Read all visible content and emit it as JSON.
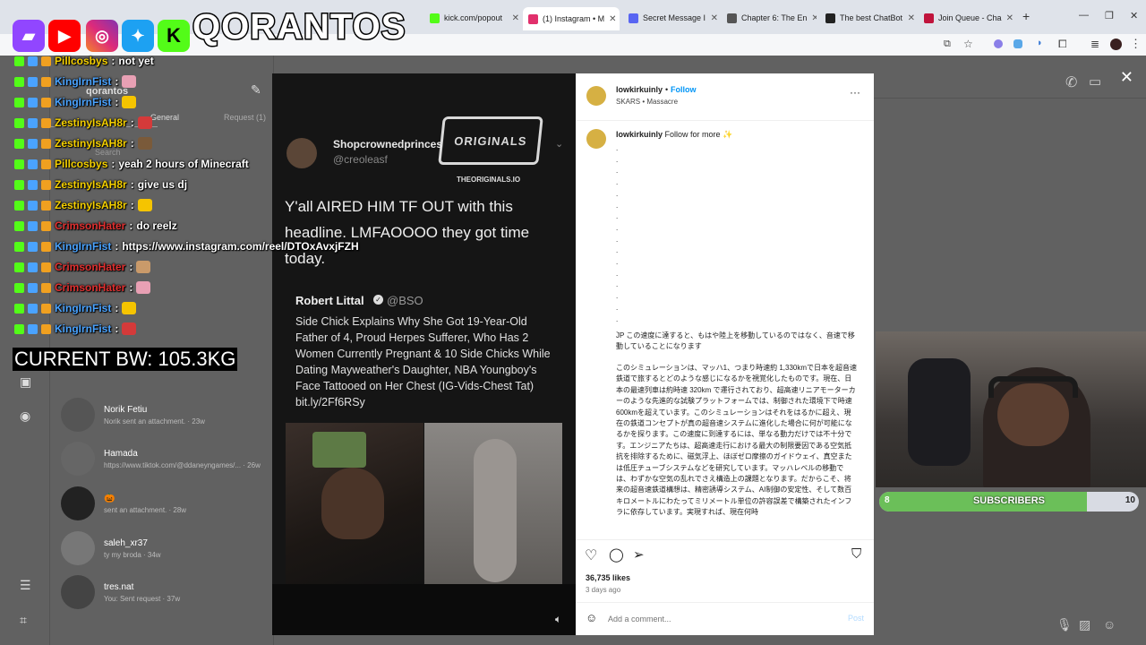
{
  "browser": {
    "tabs": [
      {
        "label": "kick.com/popout",
        "color": "#53fc18"
      },
      {
        "label": "(1) Instagram • M",
        "color": "#e1306c",
        "active": true
      },
      {
        "label": "Secret Message I",
        "color": "#5865f2"
      },
      {
        "label": "Chapter 6: The En",
        "color": "#555"
      },
      {
        "label": "The best ChatBot",
        "color": "#222"
      },
      {
        "label": "Join Queue - Cha",
        "color": "#c0143c"
      }
    ]
  },
  "instagram_bg": {
    "username": "qorantos",
    "tabs": [
      "General",
      "Request (1)"
    ],
    "search_placeholder": "Search",
    "conversations": [
      {
        "name": "Norik Fetiu",
        "preview": "Norik sent an attachment. · 23w"
      },
      {
        "name": "Hamada",
        "preview": "https://www.tiktok.com/@ddaneyngames/... · 26w"
      },
      {
        "name": "🎃",
        "preview": "sent an attachment. · 28w"
      },
      {
        "name": "saleh_xr37",
        "preview": "ty my broda · 34w"
      },
      {
        "name": "tres.nat",
        "preview": "You: Sent request · 37w"
      }
    ]
  },
  "overlay": {
    "brand": "QORANTOS",
    "bandwidth": "CURRENT BW: 105.3KG",
    "subscribers_label": "SUBSCRIBERS",
    "subscribers_current": "8",
    "subscribers_goal": "10",
    "subscribers_progress": 0.8,
    "chat": [
      {
        "user": "Pillcosbys",
        "color": "#f5d000",
        "msg": "not yet"
      },
      {
        "user": "KingIrnFist",
        "color": "#4aa3ff",
        "msg": ""
      },
      {
        "user": "KingIrnFist",
        "color": "#4aa3ff",
        "msg": ""
      },
      {
        "user": "ZestinyIsAH8r",
        "color": "#f5d000",
        "msg": ""
      },
      {
        "user": "ZestinyIsAH8r",
        "color": "#f5d000",
        "msg": ""
      },
      {
        "user": "Pillcosbys",
        "color": "#f5d000",
        "msg": "yeah 2 hours of Minecraft"
      },
      {
        "user": "ZestinyIsAH8r",
        "color": "#f5d000",
        "msg": "give us dj"
      },
      {
        "user": "ZestinyIsAH8r",
        "color": "#f5d000",
        "msg": ""
      },
      {
        "user": "CrimsonHater",
        "color": "#e03030",
        "msg": "do reelz"
      },
      {
        "user": "KingIrnFist",
        "color": "#4aa3ff",
        "msg": "https://www.instagram.com/reel/DTOxAvxjFZH"
      },
      {
        "user": "CrimsonHater",
        "color": "#e03030",
        "msg": ""
      },
      {
        "user": "CrimsonHater",
        "color": "#e03030",
        "msg": ""
      },
      {
        "user": "KingIrnFist",
        "color": "#4aa3ff",
        "msg": ""
      },
      {
        "user": "KingIrnFist",
        "color": "#4aa3ff",
        "msg": ""
      }
    ]
  },
  "post": {
    "tweet_handle_name": "Shopcrownedprinces",
    "tweet_handle": "@creoleasf",
    "tweet_text": "Y'all AIRED HIM TF OUT with this headline. LMFAOOOO they got time today.",
    "watermark": "THEORIGINALS.IO",
    "quoted_author": "Robert Littal",
    "quoted_handle": "@BSO",
    "quoted_text": "Side Chick Explains Why She Got 19-Year-Old Father of 4, Proud Herpes Sufferer, Who Has 2 Women Currently Pregnant & 10 Side Chicks While Dating Mayweather's Daughter, NBA Youngboy's Face Tattooed on Her Chest (IG-Vids-Chest Tat) bit.ly/2Ff6RSy",
    "account": "lowkirkuinly",
    "follow": "Follow",
    "audio": "SKARS • Massacre",
    "caption_prefix": "Follow for more ✨",
    "caption_jp_1": "JP この速度に達すると、もはや陸上を移動しているのではなく、音速で移動していることになります",
    "caption_jp_2": "このシミュレーションは、マッハ1、つまり時速約 1,330kmで日本を超音速鉄道で旅するとどのような感じになるかを視覚化したものです。現在、日本の最速列車は約時速 320km で運行されており、超高速リニアモーターカーのような先進的な試験プラットフォームでは、制御された環境下で時速600kmを超えています。このシミュレーションはそれをはるかに超え、現在の鉄道コンセプトが真の超音速システムに進化した場合に何が可能になるかを探ります。この速度に到達するには、単なる動力だけでは不十分です。エンジニアたちは、超高速走行における最大の制限要因である空気抵抗を排除するために、磁気浮上、ほぼゼロ摩擦のガイドウェイ、真空または低圧チューブシステムなどを研究しています。マッハレベルの移動では、わずかな空気の乱れでさえ構造上の課題となります。だからこそ、将来の超音速鉄道構想は、精密誘導システム、AI制御の安定性、そして数百キロメートルにわたってミリメートル単位の許容誤差で構築されたインフラに依存しています。実現すれば、現在何時",
    "likes": "36,735 likes",
    "date": "3 days ago",
    "comment_placeholder": "Add a comment...",
    "post_button": "Post"
  }
}
